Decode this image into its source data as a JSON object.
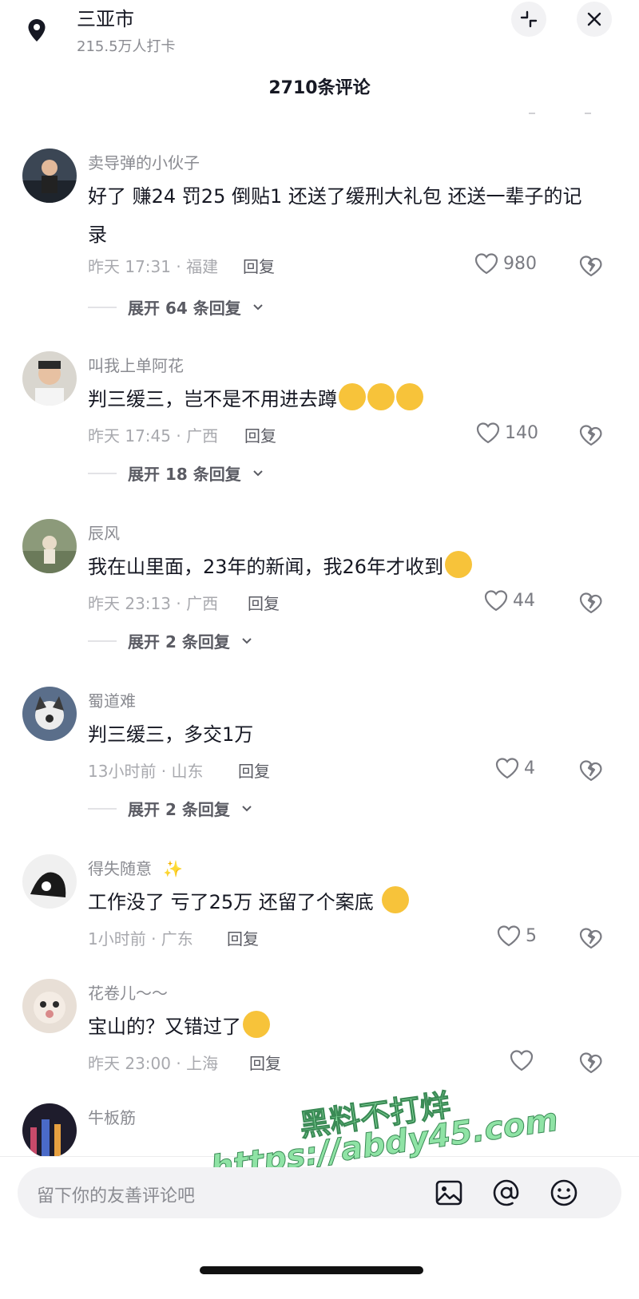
{
  "header": {
    "location_title": "三亚市",
    "checkins": "215.5万人打卡",
    "comment_count": "2710条评论"
  },
  "comments": [
    {
      "username": "卖导弹的小伙子",
      "text": "好了 赚24 罚25 倒贴1 还送了缓刑大礼包 还送一辈子的记录",
      "meta": "昨天 17:31 · 福建",
      "reply": "回复",
      "likes": "980",
      "expand": "展开 64 条回复"
    },
    {
      "username": "叫我上单阿花",
      "text": "判三缓三，岂不是不用进去蹲",
      "meta": "昨天 17:45 · 广西",
      "reply": "回复",
      "likes": "140",
      "expand": "展开 18 条回复"
    },
    {
      "username": "辰风",
      "text": "我在山里面，23年的新闻，我26年才收到",
      "meta": "昨天 23:13 · 广西",
      "reply": "回复",
      "likes": "44",
      "expand": "展开 2 条回复"
    },
    {
      "username": "蜀道难",
      "text": "判三缓三，多交1万",
      "meta": "13小时前 · 山东",
      "reply": "回复",
      "likes": "4",
      "expand": "展开 2 条回复"
    },
    {
      "username": "得失随意",
      "username_emoji": "✨",
      "text": "工作没了 亏了25万 还留了个案底",
      "meta": "1小时前 · 广东",
      "reply": "回复",
      "likes": "5"
    },
    {
      "username": "花卷儿～～",
      "text": "宝山的？又错过了",
      "meta": "昨天 23:00 · 上海",
      "reply": "回复",
      "likes": ""
    },
    {
      "username": "牛板筋"
    }
  ],
  "input": {
    "placeholder": "留下你的友善评论吧"
  },
  "watermark": {
    "line1": "黑料不打烊",
    "line2": "https://abdy45.com"
  },
  "colors": {
    "accent_text": "#161823",
    "muted_text": "#8a8b91",
    "watermark": "#8fe3a5"
  }
}
